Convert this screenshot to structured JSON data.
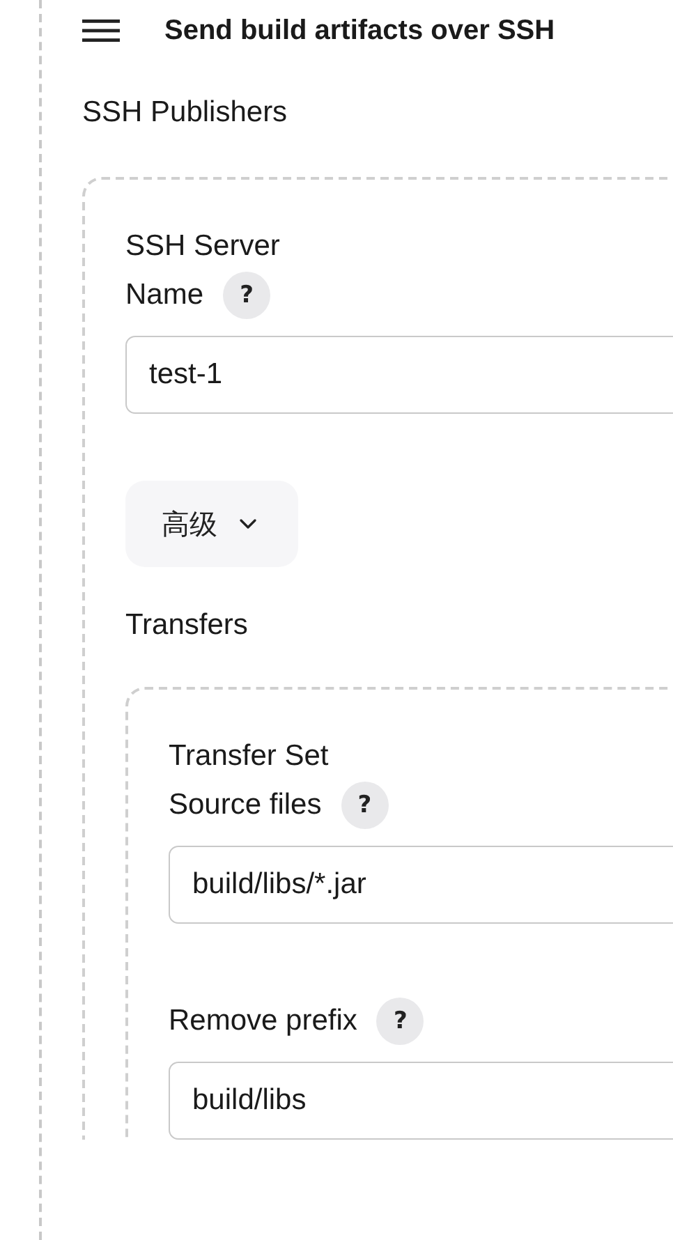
{
  "header": {
    "title": "Send build artifacts over SSH"
  },
  "section_label": "SSH Publishers",
  "publisher": {
    "title": "SSH Server",
    "fields": [
      {
        "label": "Name",
        "help": "?",
        "value": "test-1"
      }
    ],
    "advanced_button": "高级",
    "transfers_label": "Transfers",
    "transfer_set": {
      "title": "Transfer Set",
      "fields": [
        {
          "label": "Source files",
          "help": "?",
          "value": "build/libs/*.jar"
        },
        {
          "label": "Remove prefix",
          "help": "?",
          "value": "build/libs"
        }
      ]
    }
  }
}
